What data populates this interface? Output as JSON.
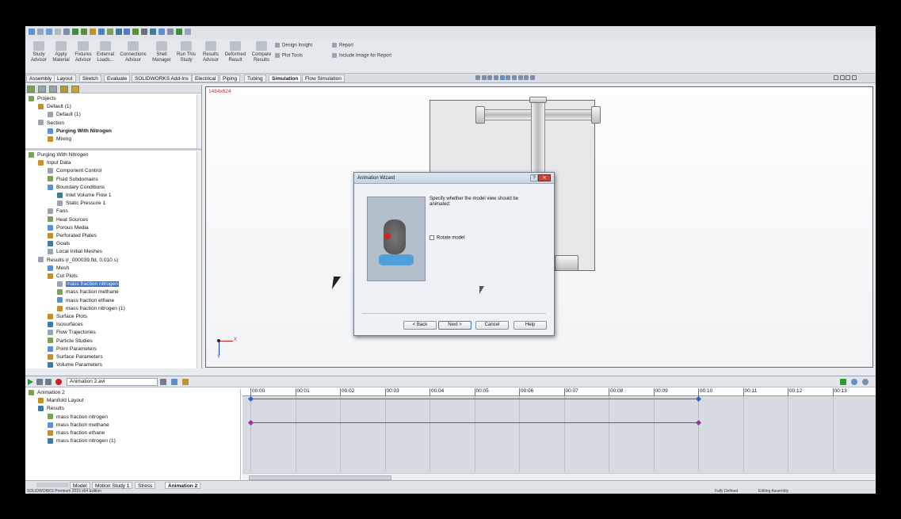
{
  "ribbon": {
    "buttons": [
      {
        "label": "Study Advisor",
        "icon": "study-advisor-icon"
      },
      {
        "label": "Apply Material",
        "icon": "apply-material-icon"
      },
      {
        "label": "Fixtures Advisor",
        "icon": "fixtures-icon"
      },
      {
        "label": "External Loads...",
        "icon": "loads-icon"
      },
      {
        "label": "Connections Advisor",
        "icon": "connections-icon"
      },
      {
        "label": "Shell Manager",
        "icon": "shell-icon"
      },
      {
        "label": "Run This Study",
        "icon": "run-icon"
      },
      {
        "label": "Results Advisor",
        "icon": "results-icon"
      },
      {
        "label": "Deformed Result",
        "icon": "deformed-icon"
      },
      {
        "label": "Compare Results",
        "icon": "compare-icon"
      }
    ],
    "small": {
      "design_insight": "Design Insight",
      "plot_tools": "Plot Tools",
      "report": "Report",
      "include_image": "Include Image for Report"
    }
  },
  "tabs": [
    "Assembly",
    "Layout",
    "Sketch",
    "Evaluate",
    "SOLIDWORKS Add-Ins",
    "Electrical",
    "Piping",
    "Tubing",
    "Simulation",
    "Flow Simulation"
  ],
  "active_tab": "Simulation",
  "projects_tree": [
    {
      "label": "Projects",
      "level": 0
    },
    {
      "label": "Default (1)",
      "level": 1
    },
    {
      "label": "Default (1)",
      "level": 2
    },
    {
      "label": "Section",
      "level": 1
    },
    {
      "label": "Purging With Nitrogen",
      "level": 2,
      "bold": true
    },
    {
      "label": "Mixing",
      "level": 2
    }
  ],
  "study_tree": [
    {
      "label": "Purging With Nitrogen",
      "level": 0
    },
    {
      "label": "Input Data",
      "level": 1
    },
    {
      "label": "Component Control",
      "level": 2
    },
    {
      "label": "Fluid Subdomains",
      "level": 2
    },
    {
      "label": "Boundary Conditions",
      "level": 2
    },
    {
      "label": "Inlet Volume Flow 1",
      "level": 3
    },
    {
      "label": "Static Pressure 1",
      "level": 3
    },
    {
      "label": "Fans",
      "level": 2
    },
    {
      "label": "Heat Sources",
      "level": 2
    },
    {
      "label": "Porous Media",
      "level": 2
    },
    {
      "label": "Perforated Plates",
      "level": 2
    },
    {
      "label": "Goals",
      "level": 2
    },
    {
      "label": "Local Initial Meshes",
      "level": 2
    },
    {
      "label": "Results (r_000039.fld, 0.010 s)",
      "level": 1
    },
    {
      "label": "Mesh",
      "level": 2
    },
    {
      "label": "Cut Plots",
      "level": 2
    },
    {
      "label": "mass fraction nitrogen",
      "level": 3,
      "selected": true
    },
    {
      "label": "mass fraction methane",
      "level": 3
    },
    {
      "label": "mass fraction ethane",
      "level": 3
    },
    {
      "label": "mass fraction nitrogen (1)",
      "level": 3
    },
    {
      "label": "Surface Plots",
      "level": 2
    },
    {
      "label": "Isosurfaces",
      "level": 2
    },
    {
      "label": "Flow Trajectories",
      "level": 2
    },
    {
      "label": "Particle Studies",
      "level": 2
    },
    {
      "label": "Point Parameters",
      "level": 2
    },
    {
      "label": "Surface Parameters",
      "level": 2
    },
    {
      "label": "Volume Parameters",
      "level": 2
    }
  ],
  "viewport": {
    "resolution": "1484x624",
    "axis_x": "X",
    "axis_y": "Y"
  },
  "dialog": {
    "title": "Animation Wizard",
    "help_glyph": "?",
    "close_glyph": "✕",
    "text": "Specify whether the model view should be animated:",
    "checkbox_label": "Rotate model",
    "checkbox_checked": false,
    "buttons": {
      "back": "< Back",
      "next": "Next >",
      "cancel": "Cancel",
      "help": "Help"
    }
  },
  "animation": {
    "filename": "Animation 2.avi",
    "tree": [
      {
        "label": "Animation 2",
        "level": 0
      },
      {
        "label": "Manifold Layout",
        "level": 1
      },
      {
        "label": "Results",
        "level": 1
      },
      {
        "label": "mass fraction nitrogen",
        "level": 2
      },
      {
        "label": "mass fraction methane",
        "level": 2
      },
      {
        "label": "mass fraction ethane",
        "level": 2
      },
      {
        "label": "mass fraction nitrogen (1)",
        "level": 2
      }
    ],
    "ticks": [
      "00:00",
      "00:01",
      "00:02",
      "00:03",
      "00:04",
      "00:05",
      "00:06",
      "00:07",
      "00:08",
      "00:09",
      "00:10",
      "00:11",
      "00:12",
      "00:13"
    ]
  },
  "bottom_tabs": [
    "Model",
    "Motion Study 1",
    "Stress",
    "Animation 2"
  ],
  "active_bottom_tab": "Animation 2",
  "status": {
    "left": "SOLIDWORKS Premium 2015 x64 Edition",
    "defined": "Fully Defined",
    "editing": "Editing Assembly"
  },
  "colors": {
    "selection": "#3b74d0",
    "viewport_border": "#d23a3a",
    "timeline_bar_1": "#3b5fd0",
    "timeline_bar_2": "#a030a0",
    "play": "#2aa02a"
  }
}
